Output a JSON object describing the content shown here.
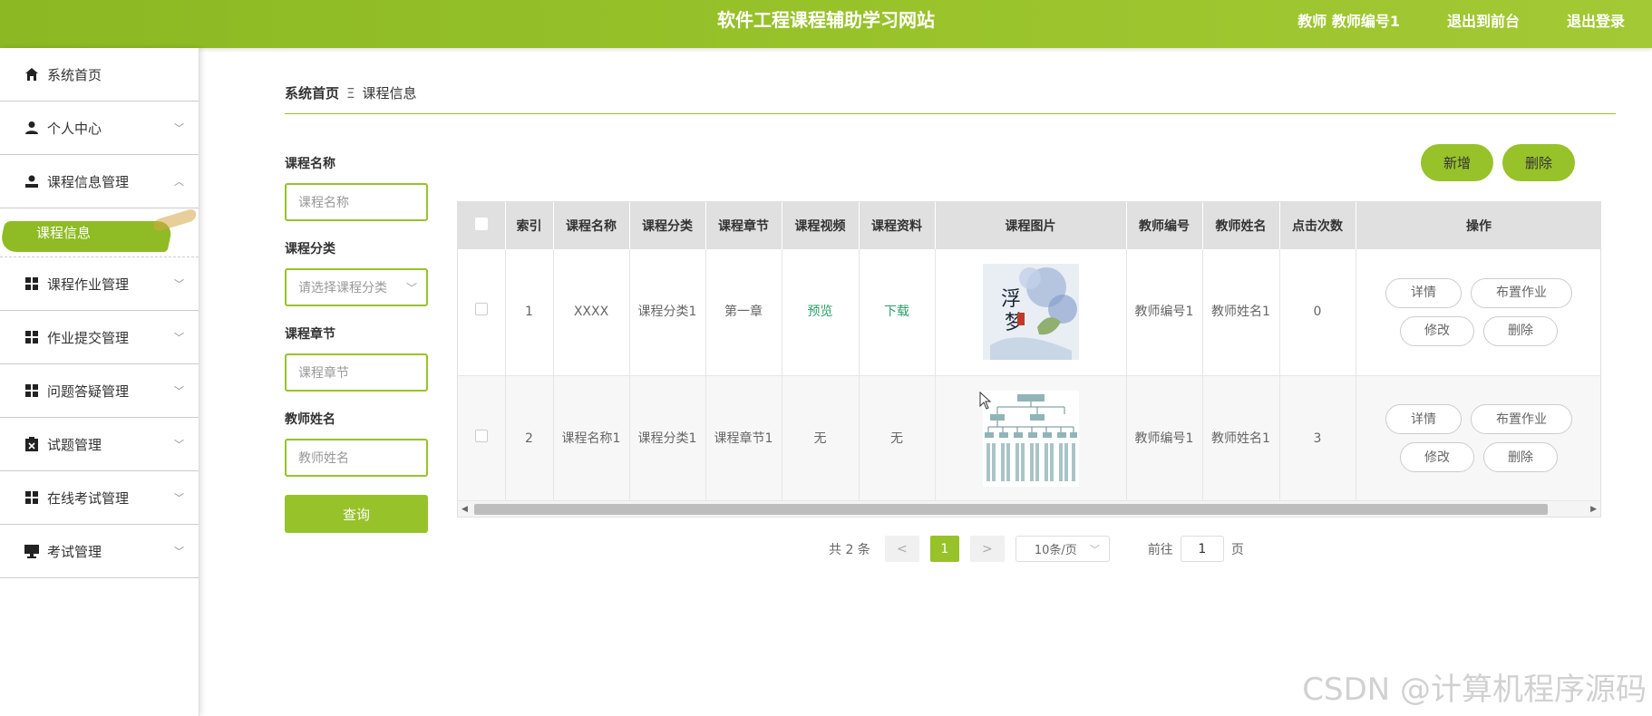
{
  "header": {
    "title": "软件工程课程辅助学习网站",
    "user": "教师 教师编号1",
    "to_front": "退出到前台",
    "logout": "退出登录"
  },
  "sidebar": {
    "items": [
      {
        "label": "系统首页",
        "icon": "home-icon",
        "arrow": ""
      },
      {
        "label": "个人中心",
        "icon": "user-icon",
        "arrow": "﹀"
      },
      {
        "label": "课程信息管理",
        "icon": "course-manage-icon",
        "arrow": "︿"
      },
      {
        "label": "课程作业管理",
        "icon": "grid-icon",
        "arrow": "﹀"
      },
      {
        "label": "作业提交管理",
        "icon": "grid-icon",
        "arrow": "﹀"
      },
      {
        "label": "问题答疑管理",
        "icon": "grid-icon",
        "arrow": "﹀"
      },
      {
        "label": "试题管理",
        "icon": "clipboard-icon",
        "arrow": "﹀"
      },
      {
        "label": "在线考试管理",
        "icon": "grid-icon",
        "arrow": "﹀"
      },
      {
        "label": "考试管理",
        "icon": "monitor-icon",
        "arrow": "﹀"
      }
    ],
    "active_sub": "课程信息"
  },
  "breadcrumb": {
    "home": "系统首页",
    "sep": "Ξ",
    "current": "课程信息"
  },
  "filters": {
    "name_label": "课程名称",
    "name_placeholder": "课程名称",
    "category_label": "课程分类",
    "category_placeholder": "请选择课程分类",
    "chapter_label": "课程章节",
    "chapter_placeholder": "课程章节",
    "teacher_label": "教师姓名",
    "teacher_placeholder": "教师姓名",
    "search": "查询"
  },
  "actions": {
    "add": "新增",
    "delete": "删除"
  },
  "table": {
    "headers": [
      "索引",
      "课程名称",
      "课程分类",
      "课程章节",
      "课程视频",
      "课程资料",
      "课程图片",
      "教师编号",
      "教师姓名",
      "点击次数",
      "操作"
    ],
    "rows": [
      {
        "index": "1",
        "name": "XXXX",
        "category": "课程分类1",
        "chapter": "第一章",
        "video": "预览",
        "material": "下载",
        "teacher_no": "教师编号1",
        "teacher_name": "教师姓名1",
        "clicks": "0"
      },
      {
        "index": "2",
        "name": "课程名称1",
        "category": "课程分类1",
        "chapter": "课程章节1",
        "video": "无",
        "material": "无",
        "teacher_no": "教师编号1",
        "teacher_name": "教师姓名1",
        "clicks": "3"
      }
    ],
    "ops": {
      "detail": "详情",
      "assign": "布置作业",
      "edit": "修改",
      "delete": "删除"
    }
  },
  "pager": {
    "total": "共 2 条",
    "prev": "<",
    "page": "1",
    "next": ">",
    "size": "10条/页",
    "goto": "前往",
    "goto_value": "1",
    "page_unit": "页"
  },
  "watermark": "CSDN @计算机程序源码",
  "colors": {
    "accent": "#98c22a",
    "link": "#2aa06a"
  }
}
